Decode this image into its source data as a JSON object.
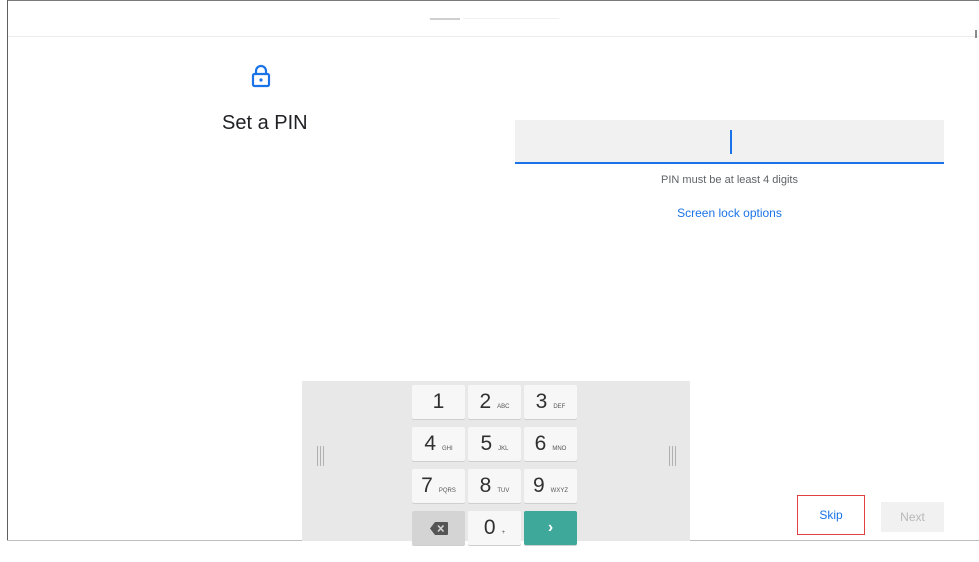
{
  "setup": {
    "title": "Set a PIN",
    "pin_value": "",
    "hint": "PIN must be at least 4 digits",
    "lock_options_link": "Screen lock options"
  },
  "keypad": {
    "keys": [
      {
        "main": "1",
        "sub": ""
      },
      {
        "main": "2",
        "sub": "ABC"
      },
      {
        "main": "3",
        "sub": "DEF"
      },
      {
        "main": "4",
        "sub": "GHI"
      },
      {
        "main": "5",
        "sub": "JKL"
      },
      {
        "main": "6",
        "sub": "MNO"
      },
      {
        "main": "7",
        "sub": "PQRS"
      },
      {
        "main": "8",
        "sub": "TUV"
      },
      {
        "main": "9",
        "sub": "WXYZ"
      },
      {
        "main": "0",
        "sub": "+"
      }
    ],
    "delete_icon": "backspace-icon",
    "enter_icon": "chevron-right-icon"
  },
  "footer": {
    "skip_label": "Skip",
    "next_label": "Next"
  },
  "colors": {
    "accent": "#1a73e8",
    "enter_key": "#3ea89a",
    "highlight_border": "#e04040"
  }
}
